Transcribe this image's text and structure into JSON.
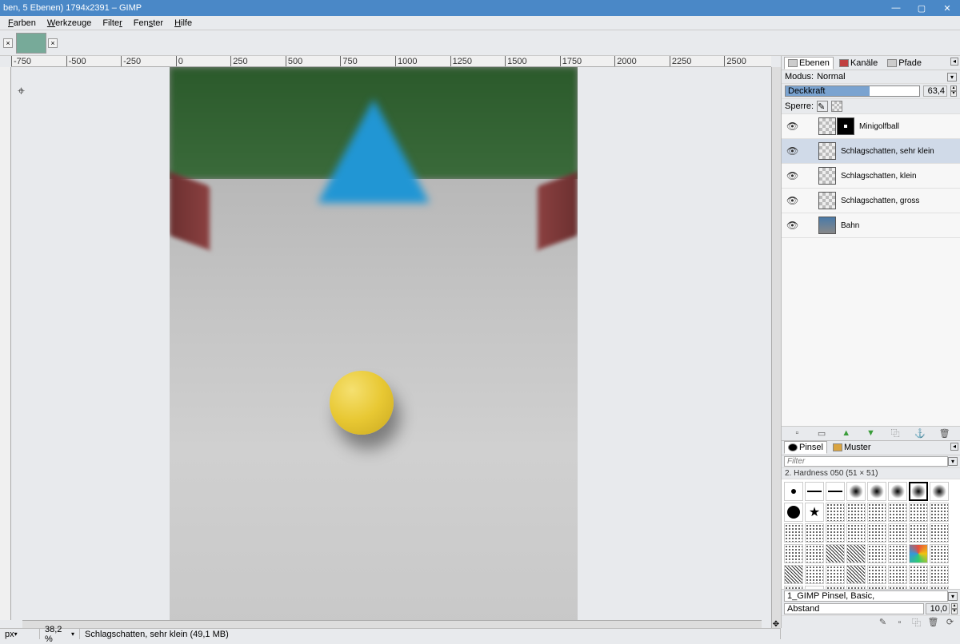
{
  "titlebar": {
    "title": "ben, 5 Ebenen) 1794x2391 – GIMP"
  },
  "menu": [
    "Farben",
    "Werkzeuge",
    "Filter",
    "Fenster",
    "Hilfe"
  ],
  "docks": {
    "layers_tabs": {
      "ebenen": "Ebenen",
      "kanale": "Kanäle",
      "pfade": "Pfade"
    },
    "mode_label": "Modus:",
    "mode_value": "Normal",
    "opacity_label": "Deckkraft",
    "opacity_value": "63,4",
    "lock_label": "Sperre:"
  },
  "layers": [
    {
      "name": "Minigolfball",
      "mask": true
    },
    {
      "name": "Schlagschatten, sehr klein",
      "selected": true
    },
    {
      "name": "Schlagschatten, klein"
    },
    {
      "name": "Schlagschatten, gross"
    },
    {
      "name": "Bahn",
      "photo": true
    }
  ],
  "brush_tabs": {
    "pinsel": "Pinsel",
    "muster": "Muster"
  },
  "brush": {
    "filter_placeholder": "Filter",
    "current": "2. Hardness 050 (51 × 51)",
    "set_name": "1_GIMP Pinsel, Basic,",
    "spacing_label": "Abstand",
    "spacing_value": "10,0"
  },
  "ruler_ticks": [
    "-750",
    "-500",
    "-250",
    "0",
    "250",
    "500",
    "750",
    "1000",
    "1250",
    "1500",
    "1750",
    "2000",
    "2250",
    "2500"
  ],
  "status": {
    "unit": "px",
    "zoom": "38,2 %",
    "msg": "Schlagschatten, sehr klein (49,1 MB)"
  }
}
